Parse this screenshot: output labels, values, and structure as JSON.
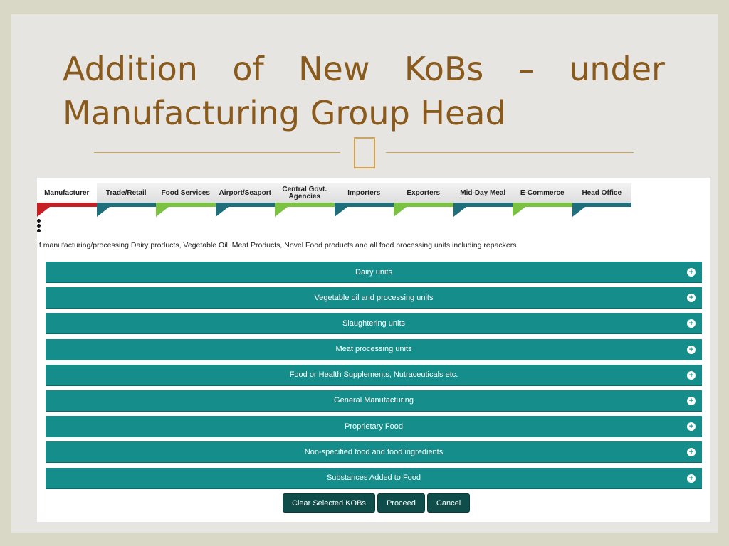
{
  "title": {
    "line1_words": [
      "Addition",
      "of",
      "New",
      "KoBs",
      "–",
      "under"
    ],
    "line2": "Manufacturing Group Head"
  },
  "tabs": [
    {
      "label": "Manufacturer",
      "color": "red",
      "active": true
    },
    {
      "label": "Trade/Retail",
      "color": "teal"
    },
    {
      "label": "Food Services",
      "color": "green"
    },
    {
      "label": "Airport/Seaport",
      "color": "teal"
    },
    {
      "label": "Central Govt. Agencies",
      "color": "green"
    },
    {
      "label": "Importers",
      "color": "teal"
    },
    {
      "label": "Exporters",
      "color": "green"
    },
    {
      "label": "Mid-Day Meal",
      "color": "teal"
    },
    {
      "label": "E-Commerce",
      "color": "green"
    },
    {
      "label": "Head Office",
      "color": "teal"
    }
  ],
  "intro_text": "If manufacturing/processing Dairy products, Vegetable Oil, Meat Products, Novel Food products and all food processing units including repackers.",
  "accordion": [
    "Dairy units",
    "Vegetable oil and processing units",
    "Slaughtering units",
    "Meat processing units",
    "Food or Health Supplements, Nutraceuticals etc.",
    "General Manufacturing",
    "Proprietary Food",
    "Non-specified food and food ingredients",
    "Substances Added to Food"
  ],
  "expand_icon": "+",
  "buttons": {
    "clear": "Clear Selected KOBs",
    "proceed": "Proceed",
    "cancel": "Cancel"
  },
  "colors": {
    "accordion": "#158d8a",
    "button": "#0f4d4b",
    "title": "#8a5a1c",
    "tab_red": "#c61f24",
    "tab_teal": "#1f6e7c",
    "tab_green": "#7bc142"
  }
}
